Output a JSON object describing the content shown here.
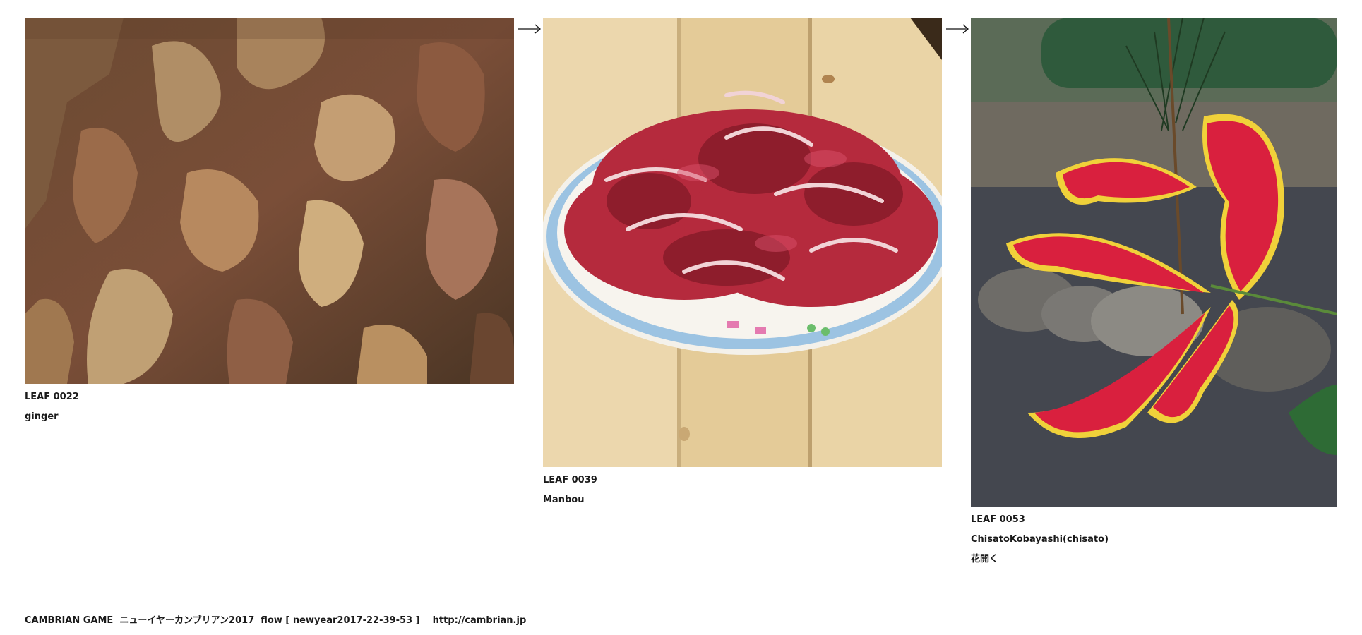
{
  "leaves": [
    {
      "id": "LEAF 0022",
      "author": "ginger",
      "note": "",
      "image": "bark camouflage texture"
    },
    {
      "id": "LEAF 0039",
      "author": "Manbou",
      "note": "",
      "image": "plate of sliced raw meat on wooden table"
    },
    {
      "id": "LEAF 0053",
      "author": "ChisatoKobayashi(chisato)",
      "note": "花開く",
      "image": "red and yellow gloriosa lily"
    }
  ],
  "arrows": [
    "right-arrow",
    "right-arrow"
  ],
  "footer": {
    "title": "CAMBRIAN GAME  ニューイヤーカンブリアン2017  flow [ newyear2017-22-39-53 ]",
    "link": "http://cambrian.jp"
  },
  "colors": {
    "background": "#ffffff",
    "text": "#1a1a1a"
  }
}
